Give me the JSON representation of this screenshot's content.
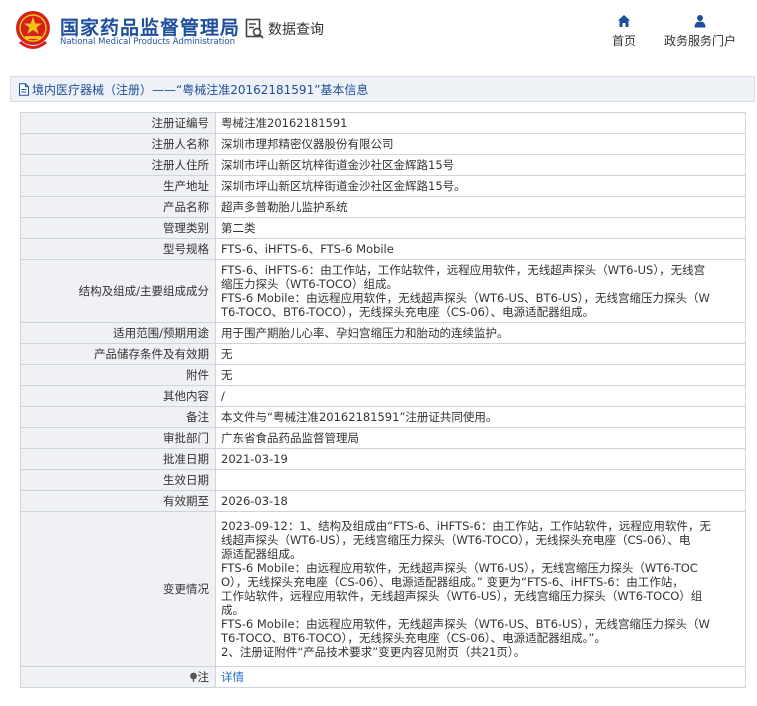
{
  "header": {
    "logo_cn": "国家药品监督管理局",
    "logo_en": "National Medical Products Administration",
    "data_query": "数据查询",
    "nav": [
      {
        "label": "首页",
        "icon": "home-icon"
      },
      {
        "label": "政务服务门户",
        "icon": "user-icon"
      }
    ]
  },
  "breadcrumb": {
    "icon": "document-icon",
    "text": "境内医疗器械（注册）——“粤械注准20162181591”基本信息"
  },
  "colors": {
    "brand_blue": "#1e4f9c",
    "emblem_red": "#d6201b",
    "link_blue": "#1e6fc8",
    "label_bg": "#eff1f4",
    "border": "#cfd4da"
  },
  "rows": [
    {
      "label": "注册证编号",
      "value": "粤械注准20162181591"
    },
    {
      "label": "注册人名称",
      "value": "深圳市理邦精密仪器股份有限公司"
    },
    {
      "label": "注册人住所",
      "value": "深圳市坪山新区坑梓街道金沙社区金辉路15号"
    },
    {
      "label": "生产地址",
      "value": "深圳市坪山新区坑梓街道金沙社区金辉路15号。"
    },
    {
      "label": "产品名称",
      "value": "超声多普勒胎儿监护系统"
    },
    {
      "label": "管理类别",
      "value": "第二类"
    },
    {
      "label": "型号规格",
      "value": "FTS-6、iHFTS-6、FTS-6 Mobile"
    },
    {
      "label": "结构及组成/主要组成成分",
      "lines": [
        "FTS-6、iHFTS-6：由工作站，工作站软件，远程应用软件，无线超声探头（WT6-US），无线宫",
        "缩压力探头（WT6-TOCO）组成。",
        "FTS-6 Mobile：由远程应用软件，无线超声探头（WT6-US、BT6-US），无线宫缩压力探头（W",
        "T6-TOCO、BT6-TOCO），无线探头充电座（CS-06）、电源适配器组成。"
      ]
    },
    {
      "label": "适用范围/预期用途",
      "value": "用于围产期胎儿心率、孕妇宫缩压力和胎动的连续监护。"
    },
    {
      "label": "产品储存条件及有效期",
      "value": "无"
    },
    {
      "label": "附件",
      "value": "无"
    },
    {
      "label": "其他内容",
      "value": "/"
    },
    {
      "label": "备注",
      "value": "本文件与“粤械注准20162181591”注册证共同使用。"
    },
    {
      "label": "审批部门",
      "value": "广东省食品药品监督管理局"
    },
    {
      "label": "批准日期",
      "value": "2021-03-19"
    },
    {
      "label": "生效日期",
      "value": ""
    },
    {
      "label": "有效期至",
      "value": "2026-03-18"
    },
    {
      "label": "变更情况",
      "lines": [
        "2023-09-12：1、结构及组成由“FTS-6、iHFTS-6：由工作站，工作站软件，远程应用软件，无",
        "线超声探头（WT6-US），无线宫缩压力探头（WT6-TOCO），无线探头充电座（CS-06）、电",
        "源适配器组成。",
        "FTS-6 Mobile：由远程应用软件，无线超声探头（WT6-US），无线宫缩压力探头（WT6-TOC",
        "O），无线探头充电座（CS-06）、电源适配器组成。” 变更为“FTS-6、iHFTS-6：由工作站，",
        "工作站软件，远程应用软件，无线超声探头（WT6-US），无线宫缩压力探头（WT6-TOCO）组",
        "成。",
        "FTS-6 Mobile：由远程应用软件，无线超声探头（WT6-US、BT6-US），无线宫缩压力探头（W",
        "T6-TOCO、BT6-TOCO），无线探头充电座（CS-06）、电源适配器组成。”。",
        "2、注册证附件“产品技术要求”变更内容见附页（共21页）。"
      ]
    },
    {
      "label": "注",
      "icon": "pin-icon",
      "link": "详情"
    }
  ]
}
